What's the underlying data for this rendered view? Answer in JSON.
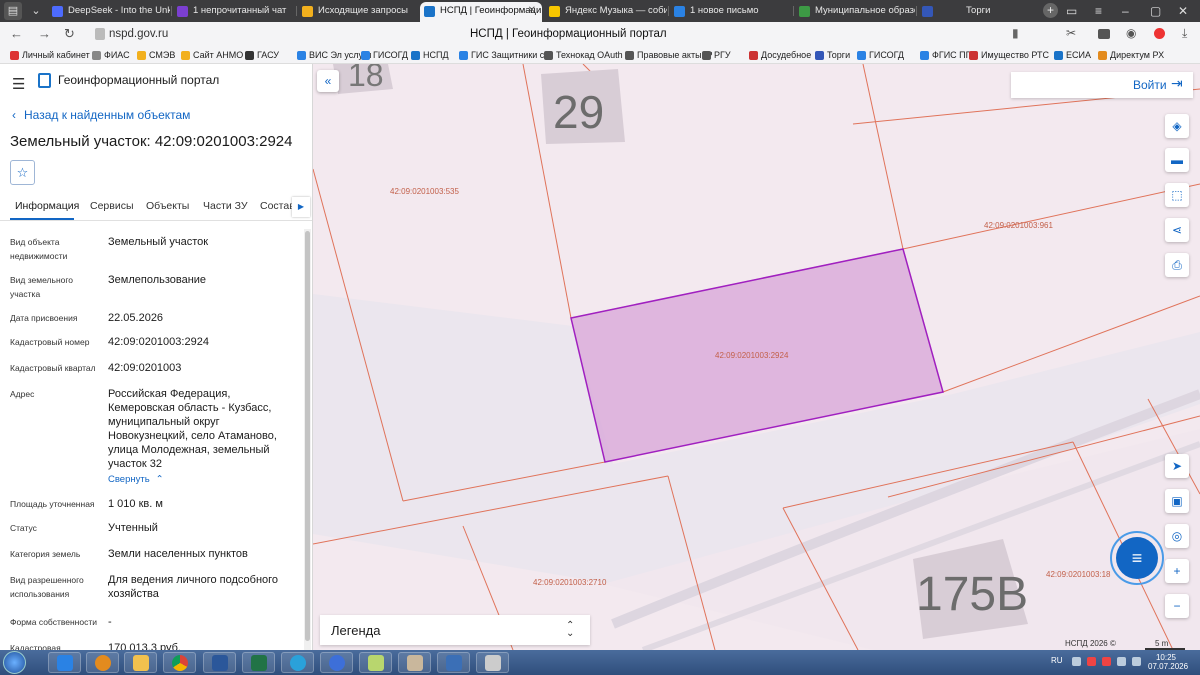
{
  "browser": {
    "tabs": [
      {
        "title": "DeepSeek - Into the Unkn",
        "icon": "deepseek-icon",
        "color": "#4d6bfe",
        "active": false
      },
      {
        "title": "1 непрочитанный чат",
        "icon": "chat-icon",
        "color": "#7b3fd1",
        "active": false
      },
      {
        "title": "Исходящие запросы",
        "icon": "folder-icon",
        "color": "#f2b01e",
        "active": false
      },
      {
        "title": "НСПД | Геоинформаци",
        "icon": "nspd-icon",
        "color": "#1a73c8",
        "active": true
      },
      {
        "title": "Яндекс Музыка — собир",
        "icon": "music-icon",
        "color": "#f7c600",
        "active": false
      },
      {
        "title": "1 новое письмо",
        "icon": "mail-icon",
        "color": "#2a82e4",
        "active": false
      },
      {
        "title": "Муниципальное образов",
        "icon": "municipal-icon",
        "color": "#3d9a45",
        "active": false
      },
      {
        "title": "Торги",
        "icon": "torgi-icon",
        "color": "#3457b8",
        "active": false
      }
    ],
    "url": "nspd.gov.ru",
    "page_title": "НСПД | Геоинформационный портал",
    "bookmarks": [
      {
        "label": "Личный кабинет",
        "color": "#d33"
      },
      {
        "label": "ФИАС",
        "color": "#888"
      },
      {
        "label": "СМЭВ",
        "color": "#f2b01e"
      },
      {
        "label": "Сайт АНМО",
        "color": "#f2b01e"
      },
      {
        "label": "ГАСУ",
        "color": "#333"
      },
      {
        "label": "ВИС Эл услуги",
        "color": "#2a82e4"
      },
      {
        "label": "ГИСОГД",
        "color": "#2a82e4"
      },
      {
        "label": "НСПД",
        "color": "#1a73c8"
      },
      {
        "label": "ГИС Защитники с",
        "color": "#2a82e4"
      },
      {
        "label": "Технокад OAuth",
        "color": "#555"
      },
      {
        "label": "Правовые акты: Р",
        "color": "#555"
      },
      {
        "label": "РГУ",
        "color": "#555"
      },
      {
        "label": "Досудебное",
        "color": "#c33"
      },
      {
        "label": "Торги",
        "color": "#3457b8"
      },
      {
        "label": "ГИСОГД",
        "color": "#2a82e4"
      },
      {
        "label": "ФГИС ПГС",
        "color": "#2a82e4"
      },
      {
        "label": "Имущество РТС",
        "color": "#c33"
      },
      {
        "label": "ЕСИА",
        "color": "#1a73c8"
      },
      {
        "label": "Директум РХ",
        "color": "#e38b1e"
      }
    ]
  },
  "app": {
    "title": "Геоинформационный портал",
    "back_label": "Назад к найденным объектам",
    "object_title": "Земельный участок: 42:09:0201003:2924",
    "tabs": [
      "Информация",
      "Сервисы",
      "Объекты",
      "Части ЗУ",
      "Состав"
    ],
    "active_tab": "Информация",
    "collapse_label": "Свернуть",
    "properties": [
      {
        "label": "Вид объекта недвижимости",
        "value": "Земельный участок"
      },
      {
        "label": "Вид земельного участка",
        "value": "Землепользование"
      },
      {
        "label": "Дата присвоения",
        "value": "22.05.2026"
      },
      {
        "label": "Кадастровый номер",
        "value": "42:09:0201003:2924"
      },
      {
        "label": "Кадастровый квартал",
        "value": "42:09:0201003"
      },
      {
        "label": "Адрес",
        "value": "Российская Федерация, Кемеровская область - Кузбасс, муниципальный округ Новокузнецкий, село Атаманово, улица Молодежная, земельный участок 32"
      },
      {
        "label": "Площадь уточненная",
        "value": "1 010 кв. м"
      },
      {
        "label": "Статус",
        "value": "Учтенный"
      },
      {
        "label": "Категория земель",
        "value": "Земли населенных пунктов"
      },
      {
        "label": "Вид разрешенного использования",
        "value": "Для ведения личного подсобного хозяйства"
      },
      {
        "label": "Форма собственности",
        "value": "-"
      },
      {
        "label": "Кадастровая",
        "value": "170 013,3 руб."
      }
    ]
  },
  "map": {
    "login_label": "Войти",
    "legend_label": "Легенда",
    "copyright": "НСПД 2026 ©",
    "scale": "5 m",
    "house_numbers": [
      "18",
      "29",
      "175В"
    ],
    "parcel_labels": {
      "p535": "42:09:0201003:535",
      "p961": "42:09:0201003:961",
      "p2924": "42:09:0201003:2924",
      "p2710": "42:09:0201003:2710",
      "p18": "42:09:0201003:18"
    },
    "tools": [
      "layers-icon",
      "ruler-icon",
      "select-area-icon",
      "share-icon",
      "print-icon",
      "locate-icon",
      "basemap-icon",
      "geo-search-icon",
      "zoom-in-icon",
      "zoom-out-icon"
    ],
    "selected_color": "#a020c0"
  },
  "taskbar": {
    "lang": "RU",
    "time": "10:25",
    "date": "07.07.2026"
  }
}
